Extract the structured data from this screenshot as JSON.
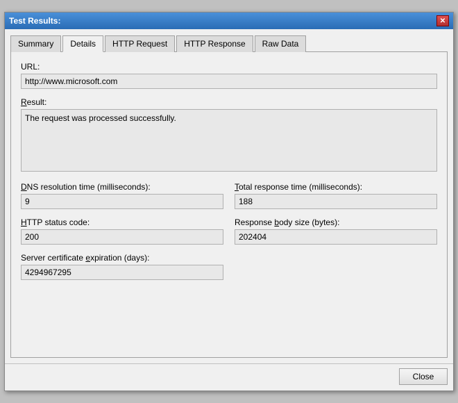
{
  "window": {
    "title": "Test Results:",
    "close_label": "✕"
  },
  "tabs": [
    {
      "id": "summary",
      "label": "Summary",
      "underline": "",
      "active": false
    },
    {
      "id": "details",
      "label": "Details",
      "underline": "D",
      "active": true
    },
    {
      "id": "http-request",
      "label": "HTTP Request",
      "underline": "H",
      "active": false
    },
    {
      "id": "http-response",
      "label": "HTTP Response",
      "underline": "R",
      "active": false
    },
    {
      "id": "raw-data",
      "label": "Raw Data",
      "underline": "a",
      "active": false
    }
  ],
  "fields": {
    "url_label": "URL:",
    "url_value": "http://www.microsoft.com",
    "result_label": "Result:",
    "result_value": "The request was processed successfully.",
    "dns_label": "DNS resolution time (milliseconds):",
    "dns_underline": "D",
    "dns_value": "9",
    "total_response_label": "Total response time (milliseconds):",
    "total_response_underline": "T",
    "total_response_value": "188",
    "http_status_label": "HTTP status code:",
    "http_status_underline": "H",
    "http_status_value": "200",
    "response_body_label": "Response body size (bytes):",
    "response_body_underline": "b",
    "response_body_value": "202404",
    "cert_label": "Server certificate expiration (days):",
    "cert_underline": "e",
    "cert_value": "4294967295"
  },
  "footer": {
    "close_label": "Close"
  }
}
